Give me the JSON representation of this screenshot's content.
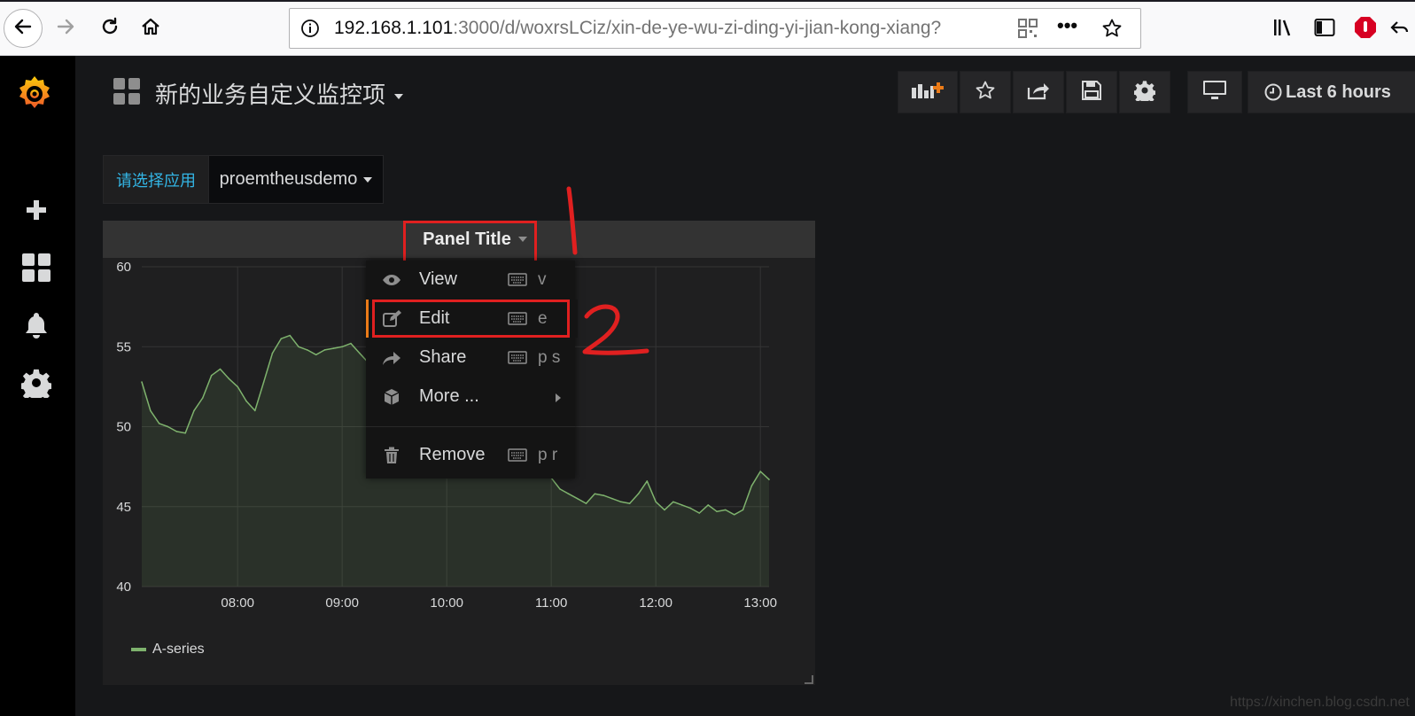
{
  "browser": {
    "url_host": "192.168.1.101",
    "url_rest": ":3000/d/woxrsLCiz/xin-de-ye-wu-zi-ding-yi-jian-kong-xiang?",
    "more_label": "•••"
  },
  "dashboard": {
    "title": "新的业务自定义监控项",
    "time_range": "Last 6 hours"
  },
  "variable": {
    "label": "请选择应用",
    "value": "proemtheusdemo"
  },
  "panel": {
    "title": "Panel Title"
  },
  "menu": {
    "items": [
      {
        "label": "View",
        "shortcut": "v",
        "icon": "eye-icon"
      },
      {
        "label": "Edit",
        "shortcut": "e",
        "icon": "edit-icon"
      },
      {
        "label": "Share",
        "shortcut": "p s",
        "icon": "share-icon"
      },
      {
        "label": "More ...",
        "shortcut": "",
        "icon": "cube-icon"
      },
      {
        "label": "Remove",
        "shortcut": "p r",
        "icon": "trash-icon"
      }
    ]
  },
  "annotations": {
    "one": "1",
    "two": "2"
  },
  "chart_data": {
    "type": "line",
    "x_labels": [
      "08:00",
      "09:00",
      "10:00",
      "11:00",
      "12:00",
      "13:00"
    ],
    "ylim": [
      40,
      60
    ],
    "yticks": [
      "60",
      "55",
      "50",
      "45",
      "40"
    ],
    "series": [
      {
        "name": "A-series",
        "color": "#7eb26d",
        "x": [
          "07:05",
          "07:10",
          "07:15",
          "07:20",
          "07:25",
          "07:30",
          "07:35",
          "07:40",
          "07:45",
          "07:50",
          "07:55",
          "08:00",
          "08:05",
          "08:10",
          "08:15",
          "08:20",
          "08:25",
          "08:30",
          "08:35",
          "08:40",
          "08:45",
          "08:50",
          "08:55",
          "09:00",
          "09:05",
          "09:10",
          "09:15",
          "09:20",
          "09:25",
          "09:30",
          "09:35",
          "09:40",
          "09:45",
          "09:50",
          "09:55",
          "10:00",
          "10:05",
          "10:10",
          "10:15",
          "10:20",
          "10:25",
          "10:30",
          "10:35",
          "10:40",
          "10:45",
          "10:50",
          "10:55",
          "11:00",
          "11:05",
          "11:10",
          "11:15",
          "11:20",
          "11:25",
          "11:30",
          "11:35",
          "11:40",
          "11:45",
          "11:50",
          "11:55",
          "12:00",
          "12:05",
          "12:10",
          "12:15",
          "12:20",
          "12:25",
          "12:30",
          "12:35",
          "12:40",
          "12:45",
          "12:50",
          "12:55",
          "13:00",
          "13:05"
        ],
        "values": [
          52.8,
          51.0,
          50.2,
          50.0,
          49.7,
          49.6,
          51.0,
          51.8,
          53.2,
          53.6,
          53.0,
          52.5,
          51.6,
          51.0,
          52.8,
          54.6,
          55.5,
          55.7,
          55.0,
          54.8,
          54.5,
          54.8,
          54.9,
          55.0,
          55.2,
          54.6,
          54.0,
          53.5,
          53.0,
          52.6,
          52.2,
          51.8,
          51.5,
          51.2,
          50.8,
          50.5,
          50.0,
          49.6,
          49.1,
          48.8,
          48.4,
          48.0,
          47.6,
          47.0,
          47.4,
          47.3,
          47.0,
          46.8,
          46.1,
          45.8,
          45.5,
          45.2,
          45.8,
          45.7,
          45.5,
          45.3,
          45.2,
          45.8,
          46.6,
          45.3,
          44.8,
          45.3,
          45.1,
          44.9,
          44.6,
          45.1,
          44.7,
          44.8,
          44.5,
          44.8,
          46.3,
          47.2,
          46.7
        ]
      }
    ]
  },
  "footer": {
    "watermark": "https://xinchen.blog.csdn.net"
  },
  "colors": {
    "background": "#161719",
    "panel": "#1f1f20",
    "accent": "#eb7b18",
    "variable_label": "#33b5e5",
    "highlight": "#e02020"
  }
}
